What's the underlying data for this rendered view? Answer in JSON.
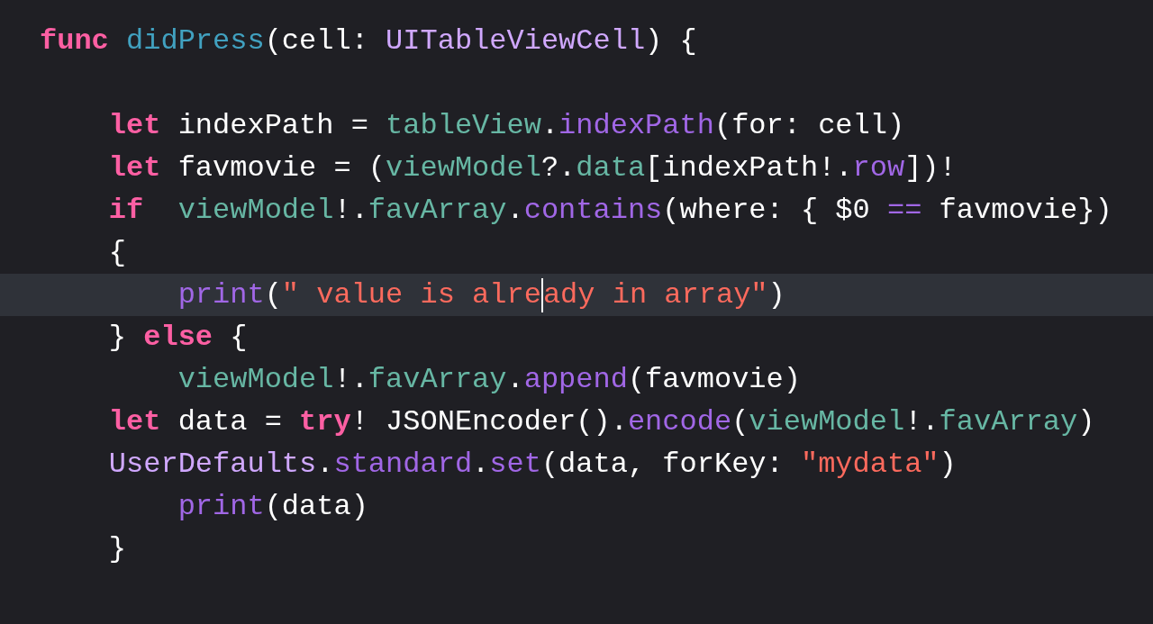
{
  "editor": {
    "lines": [
      {
        "selected": false,
        "tokens": [
          {
            "kind": "keyword",
            "text": "func"
          },
          {
            "kind": "declaration",
            "text": " didPress"
          },
          {
            "kind": "plain",
            "text": "(cell: "
          },
          {
            "kind": "type",
            "text": "UITableViewCell"
          },
          {
            "kind": "plain",
            "text": ") {"
          }
        ]
      },
      {
        "selected": false
      },
      {
        "selected": false,
        "tokens": [
          {
            "kind": "keyword",
            "text": "    let"
          },
          {
            "kind": "plain",
            "text": " indexPath = "
          },
          {
            "kind": "variable",
            "text": "tableView"
          },
          {
            "kind": "plain",
            "text": "."
          },
          {
            "kind": "method",
            "text": "indexPath"
          },
          {
            "kind": "plain",
            "text": "(for: cell)"
          }
        ]
      },
      {
        "selected": false,
        "tokens": [
          {
            "kind": "keyword",
            "text": "    let"
          },
          {
            "kind": "plain",
            "text": " favmovie = ("
          },
          {
            "kind": "variable",
            "text": "viewModel"
          },
          {
            "kind": "plain",
            "text": "?."
          },
          {
            "kind": "variable",
            "text": "data"
          },
          {
            "kind": "plain",
            "text": "[indexPath!."
          },
          {
            "kind": "method",
            "text": "row"
          },
          {
            "kind": "plain",
            "text": "])!"
          }
        ]
      },
      {
        "selected": false,
        "tokens": [
          {
            "kind": "keyword",
            "text": "    if"
          },
          {
            "kind": "variable",
            "text": "  viewModel"
          },
          {
            "kind": "plain",
            "text": "!."
          },
          {
            "kind": "variable",
            "text": "favArray"
          },
          {
            "kind": "plain",
            "text": "."
          },
          {
            "kind": "method",
            "text": "contains"
          },
          {
            "kind": "plain",
            "text": "(where: { $0 "
          },
          {
            "kind": "method",
            "text": "=="
          },
          {
            "kind": "plain",
            "text": " favmovie})"
          }
        ]
      },
      {
        "selected": false,
        "tokens": [
          {
            "kind": "plain",
            "text": "    {"
          }
        ]
      },
      {
        "selected": true,
        "tokens": [
          {
            "kind": "method",
            "text": "        print"
          },
          {
            "kind": "plain",
            "text": "("
          },
          {
            "kind": "string",
            "text": "\" value is alre",
            "cursor_after": true
          },
          {
            "kind": "string",
            "text": "ady in array\""
          },
          {
            "kind": "plain",
            "text": ")"
          }
        ]
      },
      {
        "selected": false,
        "tokens": [
          {
            "kind": "plain",
            "text": "    }"
          },
          {
            "kind": "keyword",
            "text": " else"
          },
          {
            "kind": "plain",
            "text": " {"
          }
        ]
      },
      {
        "selected": false,
        "tokens": [
          {
            "kind": "variable",
            "text": "        viewModel"
          },
          {
            "kind": "plain",
            "text": "!."
          },
          {
            "kind": "variable",
            "text": "favArray"
          },
          {
            "kind": "plain",
            "text": "."
          },
          {
            "kind": "method",
            "text": "append"
          },
          {
            "kind": "plain",
            "text": "(favmovie)"
          }
        ]
      },
      {
        "selected": false,
        "tokens": [
          {
            "kind": "keyword",
            "text": "    let"
          },
          {
            "kind": "plain",
            "text": " data = "
          },
          {
            "kind": "keyword",
            "text": "try"
          },
          {
            "kind": "plain",
            "text": "! JSONEncoder()."
          },
          {
            "kind": "method",
            "text": "encode"
          },
          {
            "kind": "plain",
            "text": "("
          },
          {
            "kind": "variable",
            "text": "viewModel"
          },
          {
            "kind": "plain",
            "text": "!."
          },
          {
            "kind": "variable",
            "text": "favArray"
          },
          {
            "kind": "plain",
            "text": ")"
          }
        ]
      },
      {
        "selected": false,
        "tokens": [
          {
            "kind": "type",
            "text": "    UserDefaults"
          },
          {
            "kind": "plain",
            "text": "."
          },
          {
            "kind": "method",
            "text": "standard"
          },
          {
            "kind": "plain",
            "text": "."
          },
          {
            "kind": "method",
            "text": "set"
          },
          {
            "kind": "plain",
            "text": "(data, forKey: "
          },
          {
            "kind": "string",
            "text": "\"mydata\""
          },
          {
            "kind": "plain",
            "text": ")"
          }
        ]
      },
      {
        "selected": false,
        "tokens": [
          {
            "kind": "method",
            "text": "        print"
          },
          {
            "kind": "plain",
            "text": "(data)"
          }
        ]
      },
      {
        "selected": false,
        "tokens": [
          {
            "kind": "plain",
            "text": "    }"
          }
        ]
      }
    ]
  }
}
